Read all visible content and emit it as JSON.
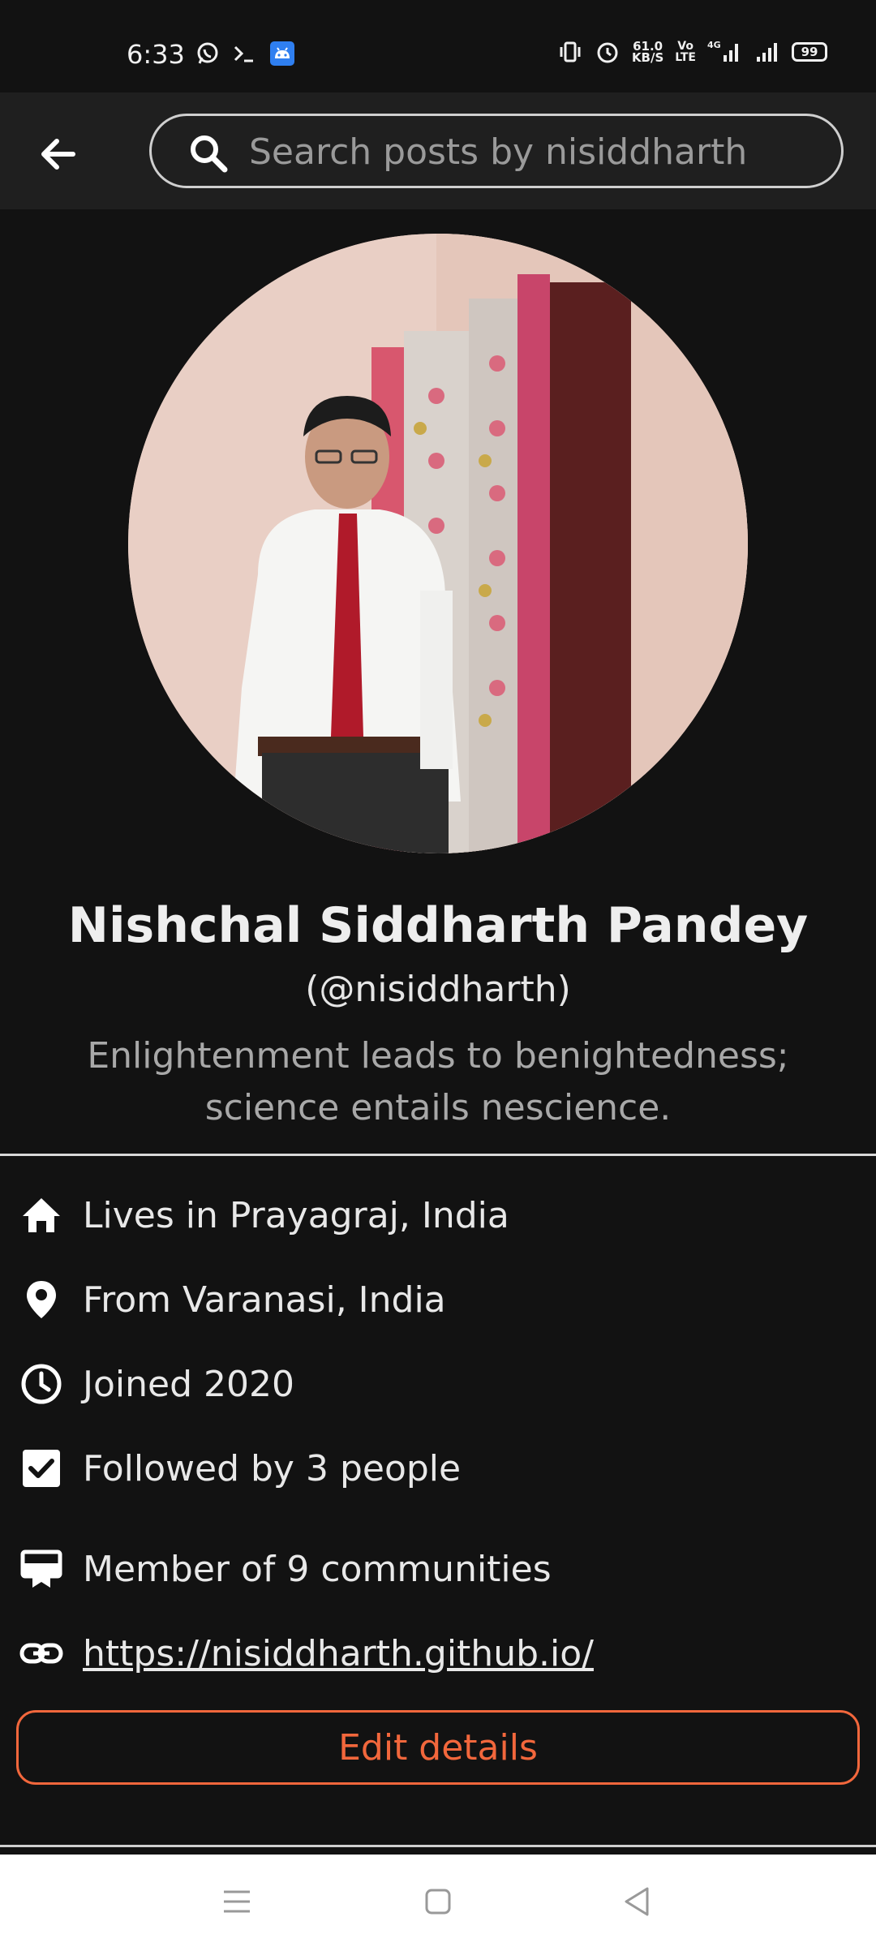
{
  "status_bar": {
    "time": "6:33",
    "speed_value": "61.0",
    "speed_unit": "KB/S",
    "volte_top": "Vo",
    "volte_bottom": "LTE",
    "network": "4G",
    "battery": "99",
    "icons": [
      "whatsapp-icon",
      "terminal-icon",
      "android-icon",
      "vibrate-icon",
      "alarm-icon",
      "signal-icon",
      "signal-icon"
    ]
  },
  "header": {
    "back_icon": "arrow-left-icon",
    "search_placeholder": "Search posts by nisiddharth"
  },
  "profile": {
    "name": "Nishchal Siddharth Pandey",
    "handle": "(@nisiddharth)",
    "bio": "Enlightenment leads to benightedness; science entails nescience."
  },
  "details": [
    {
      "icon": "home-icon",
      "text": "Lives in Prayagraj, India"
    },
    {
      "icon": "location-pin-icon",
      "text": "From Varanasi, India"
    },
    {
      "icon": "clock-icon",
      "text": "Joined 2020"
    },
    {
      "icon": "checkbox-icon",
      "text": "Followed by 3 people"
    },
    {
      "icon": "community-icon",
      "text": "Member of 9 communities"
    },
    {
      "icon": "link-icon",
      "text": "https://nisiddharth.github.io/"
    }
  ],
  "edit_button": "Edit details",
  "colors": {
    "background": "#121212",
    "header": "#1f1f1f",
    "accent": "#f2673c",
    "text_primary": "#e8e8e8",
    "text_secondary": "#a8a8a8"
  }
}
